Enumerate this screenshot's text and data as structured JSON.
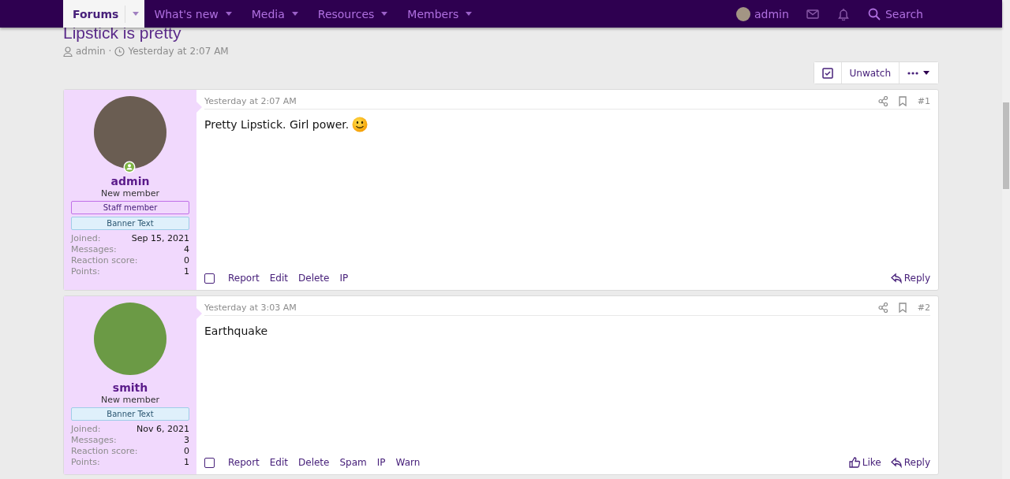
{
  "nav": {
    "tabs": [
      {
        "label": "Forums",
        "selected": true
      },
      {
        "label": "What's new",
        "selected": false
      },
      {
        "label": "Media",
        "selected": false
      },
      {
        "label": "Resources",
        "selected": false
      },
      {
        "label": "Members",
        "selected": false
      }
    ],
    "user": "admin",
    "search": "Search"
  },
  "thread": {
    "title": "Lipstick is pretty",
    "author": "admin",
    "separator": "·",
    "date": "Yesterday at 2:07 AM"
  },
  "thread_buttons": {
    "unwatch": "Unwatch"
  },
  "posts": [
    {
      "user": {
        "name": "admin",
        "title": "New member",
        "online": true,
        "banners": [
          {
            "text": "Staff member",
            "kind": "staff"
          },
          {
            "text": "Banner Text",
            "kind": "info"
          }
        ],
        "stats": [
          {
            "label": "Joined:",
            "value": "Sep 15, 2021"
          },
          {
            "label": "Messages:",
            "value": "4"
          },
          {
            "label": "Reaction score:",
            "value": "0"
          },
          {
            "label": "Points:",
            "value": "1"
          }
        ]
      },
      "date": "Yesterday at 2:07 AM",
      "number": "#1",
      "body": "Pretty Lipstick. Girl power.",
      "smiley": true,
      "checked": false,
      "actions": [
        "Report",
        "Edit",
        "Delete",
        "IP"
      ],
      "reactions": [
        {
          "kind": "reply",
          "label": "Reply"
        }
      ]
    },
    {
      "user": {
        "name": "smith",
        "title": "New member",
        "online": false,
        "banners": [
          {
            "text": "Banner Text",
            "kind": "info"
          }
        ],
        "stats": [
          {
            "label": "Joined:",
            "value": "Nov 6, 2021"
          },
          {
            "label": "Messages:",
            "value": "3"
          },
          {
            "label": "Reaction score:",
            "value": "0"
          },
          {
            "label": "Points:",
            "value": "1"
          }
        ]
      },
      "date": "Yesterday at 3:03 AM",
      "number": "#2",
      "body": "Earthquake",
      "smiley": false,
      "checked": false,
      "actions": [
        "Report",
        "Edit",
        "Delete",
        "Spam",
        "IP",
        "Warn"
      ],
      "reactions": [
        {
          "kind": "like",
          "label": "Like"
        },
        {
          "kind": "reply",
          "label": "Reply"
        }
      ]
    }
  ]
}
